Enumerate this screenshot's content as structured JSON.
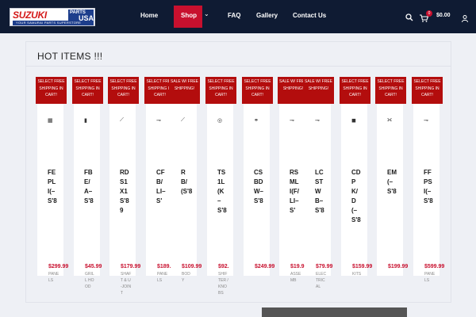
{
  "header": {
    "logo_main": "SUZUKI",
    "logo_parts": "PARTS",
    "logo_usa": "USA",
    "logo_tagline": "YOUR SAMURAI PARTS SUPERSTORE",
    "nav": [
      "Home",
      "Shop",
      "FAQ",
      "Gallery",
      "Contact Us"
    ],
    "cart_count": "0",
    "cart_total": "$0.00"
  },
  "section": {
    "title": "HOT ITEMS !!!"
  },
  "products": [
    {
      "badge": "SELECT FREE SHIPPING IN CART!",
      "name": "FEPLI(–S'8",
      "price": "$299.99",
      "old": "",
      "cat": "PANELS"
    },
    {
      "badge": "SELECT FREE SHIPPING IN CART!",
      "name": "FBE/A–S'8",
      "price": "$45.99",
      "old": "",
      "cat": "GRILL HOOD"
    },
    {
      "badge": "SELECT FREE SHIPPING IN CART!",
      "name": "RDS1X1S'89",
      "price": "$179.99",
      "old": "",
      "cat": "SHAFT & U-JOINT"
    },
    {
      "badge": "SELECT FREE SHIPPING IN CART!",
      "name": "CFB/LI–S'",
      "price": "$189.",
      "old": "",
      "cat": "PANELS"
    },
    {
      "badge": "SALE W/ FREE SHIPPING!",
      "name": "RB/(S'8",
      "price": "$109.99",
      "old": "",
      "cat": "BODY"
    },
    {
      "badge": "SELECT FREE SHIPPING IN CART!",
      "name": "TS1L(K–S'8",
      "price": "$92.",
      "old": "",
      "cat": "SHIFTER / KNOBS"
    },
    {
      "badge": "SELECT FREE SHIPPING IN CART!",
      "name": "CSBDW–S'8",
      "price": "$249.99",
      "old": "",
      "cat": ""
    },
    {
      "badge": "SALE W/ FREE SHIPPING!",
      "name": "RSMLI(F/LI–S'",
      "price": "$19.9",
      "old": "",
      "cat": "ASSEMB"
    },
    {
      "badge": "SALE W/ FREE SHIPPING!",
      "name": "LCSTWB–S'8",
      "price": "$79.99",
      "old": "",
      "cat": "ELECTRICAL"
    },
    {
      "badge": "SELECT FREE SHIPPING IN CART!",
      "name": "CDPK/D(–S'8",
      "price": "$159.99",
      "old": "",
      "cat": "KITS"
    },
    {
      "badge": "SELECT FREE SHIPPING IN CART!",
      "name": "EM(–S'8",
      "price": "$199.99",
      "old": "",
      "cat": ""
    },
    {
      "badge": "SELECT FREE SHIPPING IN CART!",
      "name": "FFPSI(–S'8",
      "price": "$599.99",
      "old": "",
      "cat": "PANELS"
    }
  ]
}
